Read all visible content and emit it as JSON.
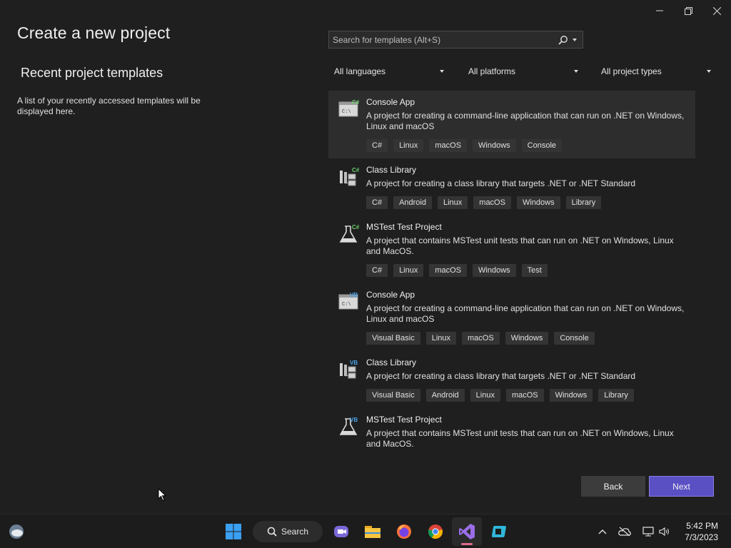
{
  "window": {
    "title": "Create a new project",
    "controls": {
      "minimize": "minimize-icon",
      "restore": "restore-icon",
      "close": "close-icon"
    }
  },
  "recent": {
    "title": "Recent project templates",
    "description": "A list of your recently accessed templates will be displayed here."
  },
  "search": {
    "placeholder": "Search for templates (Alt+S)",
    "value": ""
  },
  "filters": {
    "language": "All languages",
    "platform": "All platforms",
    "project_type": "All project types"
  },
  "templates": [
    {
      "name": "Console App",
      "lang_badge": "C#",
      "icon": "console-app-csharp-icon",
      "description": "A project for creating a command-line application that can run on .NET on Windows, Linux and macOS",
      "tags": [
        "C#",
        "Linux",
        "macOS",
        "Windows",
        "Console"
      ],
      "selected": true
    },
    {
      "name": "Class Library",
      "lang_badge": "C#",
      "icon": "class-library-csharp-icon",
      "description": "A project for creating a class library that targets .NET or .NET Standard",
      "tags": [
        "C#",
        "Android",
        "Linux",
        "macOS",
        "Windows",
        "Library"
      ]
    },
    {
      "name": "MSTest Test Project",
      "lang_badge": "C#",
      "icon": "mstest-csharp-icon",
      "description": "A project that contains MSTest unit tests that can run on .NET on Windows, Linux and MacOS.",
      "tags": [
        "C#",
        "Linux",
        "macOS",
        "Windows",
        "Test"
      ]
    },
    {
      "name": "Console App",
      "lang_badge": "VB",
      "icon": "console-app-vb-icon",
      "description": "A project for creating a command-line application that can run on .NET on Windows, Linux and macOS",
      "tags": [
        "Visual Basic",
        "Linux",
        "macOS",
        "Windows",
        "Console"
      ]
    },
    {
      "name": "Class Library",
      "lang_badge": "VB",
      "icon": "class-library-vb-icon",
      "description": "A project for creating a class library that targets .NET or .NET Standard",
      "tags": [
        "Visual Basic",
        "Android",
        "Linux",
        "macOS",
        "Windows",
        "Library"
      ]
    },
    {
      "name": "MSTest Test Project",
      "lang_badge": "VB",
      "icon": "mstest-vb-icon",
      "description": "A project that contains MSTest unit tests that can run on .NET on Windows, Linux and MacOS.",
      "tags": []
    }
  ],
  "buttons": {
    "back": "Back",
    "next": "Next"
  },
  "colors": {
    "accent": "#5b4fc4",
    "background": "#1f1f1f",
    "tag_bg": "#343434",
    "selected_bg": "#2d2d2d"
  },
  "taskbar": {
    "search_label": "Search",
    "apps": [
      "windows-start-icon",
      "search-icon",
      "teams-chat-icon",
      "file-explorer-icon",
      "firefox-icon",
      "chrome-icon",
      "visual-studio-icon",
      "remote-desktop-icon"
    ],
    "time": "5:42 PM",
    "date": "7/3/2023"
  }
}
